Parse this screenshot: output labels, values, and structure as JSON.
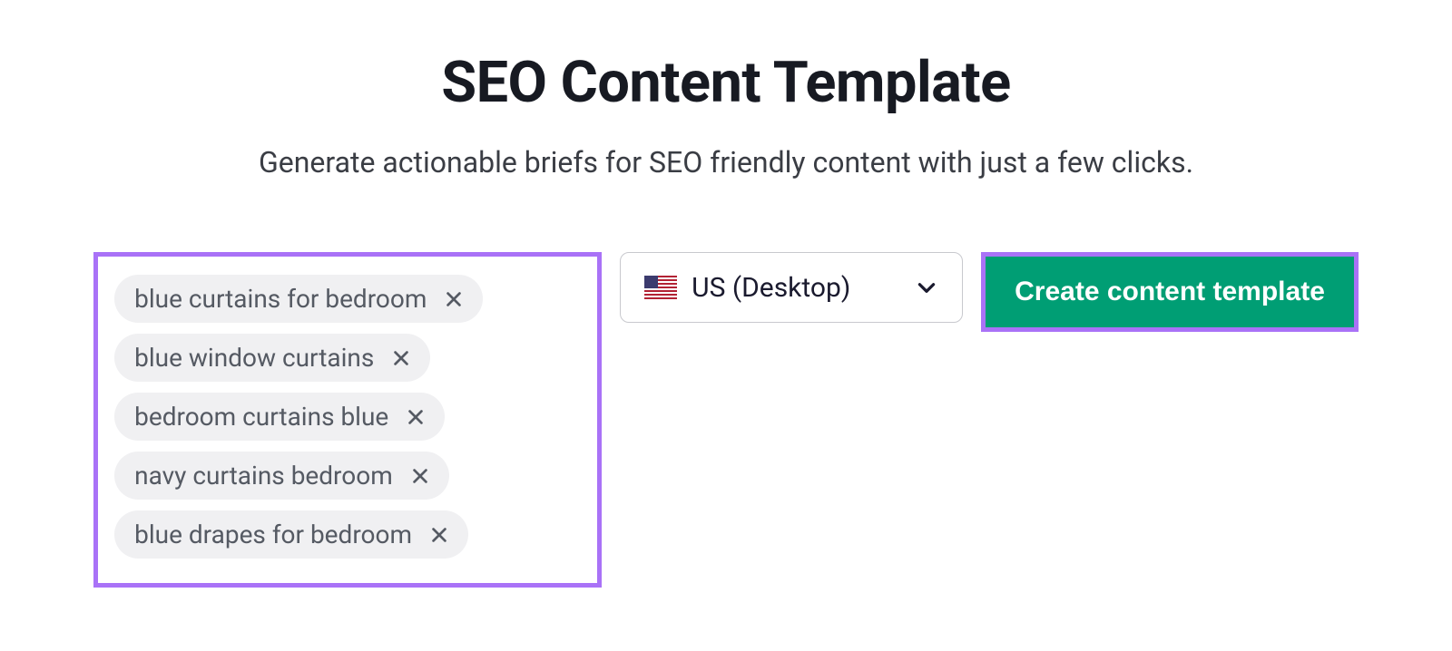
{
  "header": {
    "title": "SEO Content Template",
    "subtitle": "Generate actionable briefs for SEO friendly content with just a few clicks."
  },
  "keywords": [
    "blue curtains for bedroom",
    "blue window curtains",
    "bedroom curtains blue",
    "navy curtains bedroom",
    "blue drapes for bedroom"
  ],
  "locale": {
    "selected_label": "US (Desktop)",
    "flag": "us"
  },
  "cta": {
    "label": "Create content template"
  },
  "colors": {
    "highlight_border": "#a972f7",
    "cta_bg": "#009e74",
    "chip_bg": "#f0f0f2",
    "chip_text": "#555a63"
  }
}
